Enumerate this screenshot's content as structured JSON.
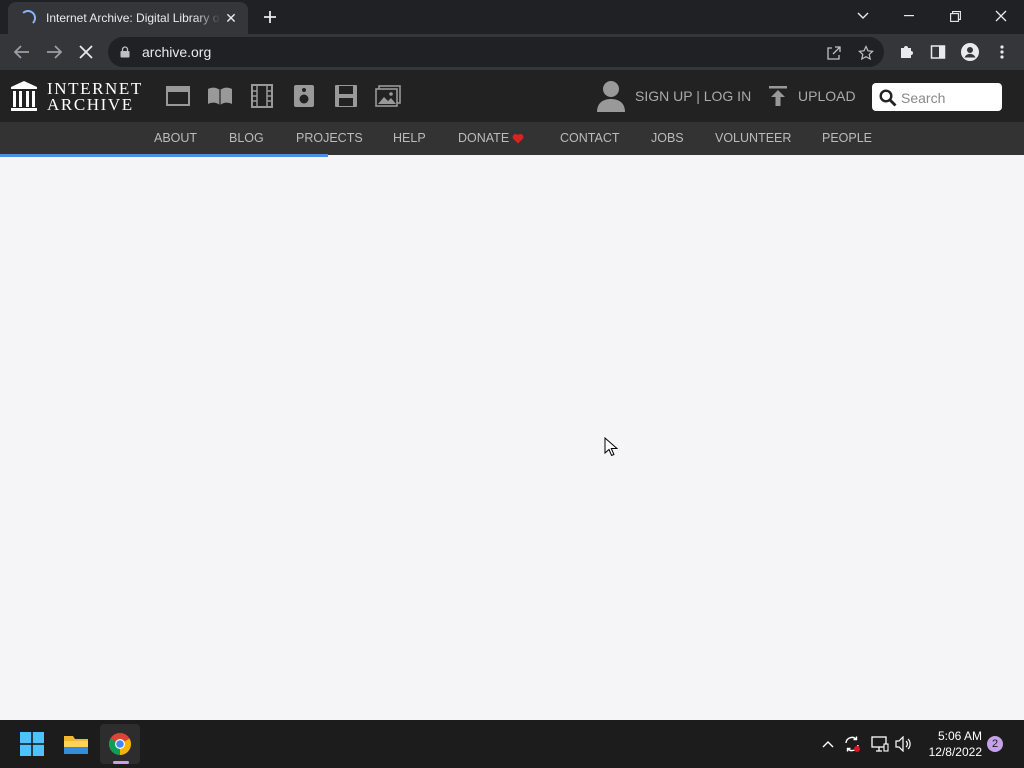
{
  "browser": {
    "tab_title": "Internet Archive: Digital Library of Free & Borrowable Books, Movies, Music & Wayback Machine",
    "url": "archive.org",
    "colors": {
      "tab_bg": "#35363a",
      "strip_bg": "#202124",
      "spinner": "#8ab4f8"
    }
  },
  "site": {
    "logo_line1": "INTERNET",
    "logo_line2": "ARCHIVE",
    "media_icons": [
      "web-icon",
      "texts-icon",
      "video-icon",
      "audio-icon",
      "software-icon",
      "images-icon"
    ],
    "signup_label": "SIGN UP | LOG IN",
    "upload_label": "UPLOAD",
    "search_placeholder": "Search",
    "subnav": [
      "ABOUT",
      "BLOG",
      "PROJECTS",
      "HELP",
      "DONATE",
      "CONTACT",
      "JOBS",
      "VOLUNTEER",
      "PEOPLE"
    ],
    "colors": {
      "top_bg": "#222222",
      "sub_bg": "#333333",
      "heart": "#e02020",
      "progress": "#4a90e2"
    }
  },
  "page_load_progress": 0.32,
  "taskbar": {
    "time": "5:06 AM",
    "date": "12/8/2022",
    "notification_count": "2",
    "apps": [
      "windows-start-icon",
      "file-explorer-icon",
      "chrome-icon"
    ]
  }
}
